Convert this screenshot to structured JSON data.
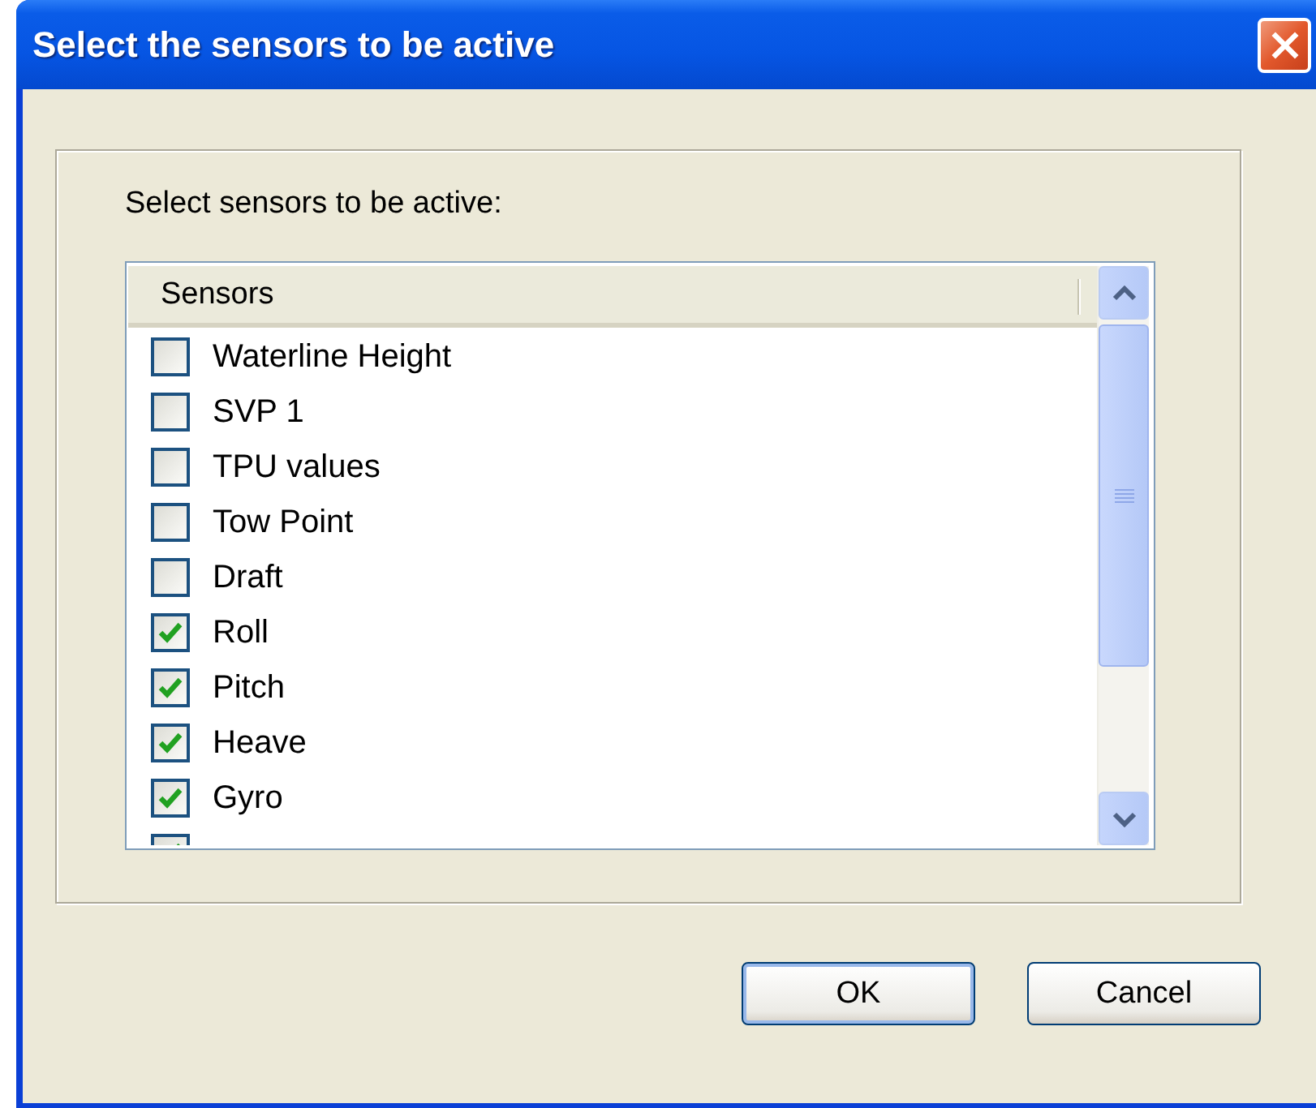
{
  "window": {
    "title": "Select the sensors to be active"
  },
  "prompt": "Select sensors to be active:",
  "list": {
    "column": "Sensors",
    "items": [
      {
        "label": "Waterline Height",
        "checked": false
      },
      {
        "label": "SVP 1",
        "checked": false
      },
      {
        "label": "TPU values",
        "checked": false
      },
      {
        "label": "Tow Point",
        "checked": false
      },
      {
        "label": "Draft",
        "checked": false
      },
      {
        "label": "Roll",
        "checked": true
      },
      {
        "label": "Pitch",
        "checked": true
      },
      {
        "label": "Heave",
        "checked": true
      },
      {
        "label": "Gyro",
        "checked": true
      },
      {
        "checked": true
      }
    ]
  },
  "buttons": [
    {
      "label": "OK",
      "default": true
    },
    {
      "label": "Cancel",
      "default": false
    }
  ]
}
